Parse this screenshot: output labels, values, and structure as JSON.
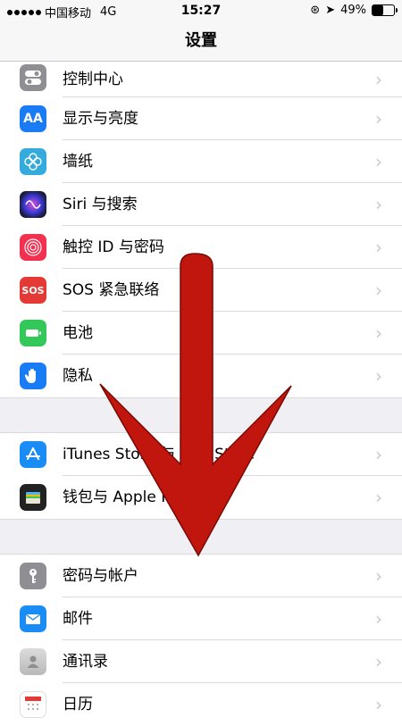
{
  "status": {
    "carrier": "中国移动",
    "network": "4G",
    "time": "15:27",
    "battery": "49%",
    "battery_level": 0.49
  },
  "nav": {
    "title": "设置"
  },
  "groups": [
    {
      "items": [
        {
          "label": "控制中心",
          "icon": "control-center-icon",
          "color": "#8e8e93"
        },
        {
          "label": "显示与亮度",
          "icon": "display-brightness-icon",
          "color": "#1a7cf5",
          "glyph": "AA"
        },
        {
          "label": "墙纸",
          "icon": "wallpaper-icon",
          "color": "#35aadc"
        },
        {
          "label": "Siri 与搜索",
          "icon": "siri-icon",
          "color": "#1c1c3a"
        },
        {
          "label": "触控 ID 与密码",
          "icon": "touch-id-icon",
          "color": "#f2304f"
        },
        {
          "label": "SOS 紧急联络",
          "icon": "sos-icon",
          "color": "#e53935",
          "glyph": "SOS"
        },
        {
          "label": "电池",
          "icon": "battery-icon",
          "color": "#34c759"
        },
        {
          "label": "隐私",
          "icon": "privacy-hand-icon",
          "color": "#1a7cf5"
        }
      ]
    },
    {
      "items": [
        {
          "label": "iTunes Store 与 App Store",
          "icon": "app-store-icon",
          "color": "#1a8cf5"
        },
        {
          "label": "钱包与 Apple Pay",
          "icon": "wallet-icon",
          "color": "#222222"
        }
      ]
    },
    {
      "items": [
        {
          "label": "密码与帐户",
          "icon": "key-icon",
          "color": "#8e8e93"
        },
        {
          "label": "邮件",
          "icon": "mail-icon",
          "color": "#1a8cf5"
        },
        {
          "label": "通讯录",
          "icon": "contacts-icon",
          "color": "#c9c9c9"
        },
        {
          "label": "日历",
          "icon": "calendar-icon",
          "color": "#ffffff"
        }
      ]
    }
  ],
  "chevron": "›",
  "overlay": {
    "arrow_color": "#c0160e"
  }
}
